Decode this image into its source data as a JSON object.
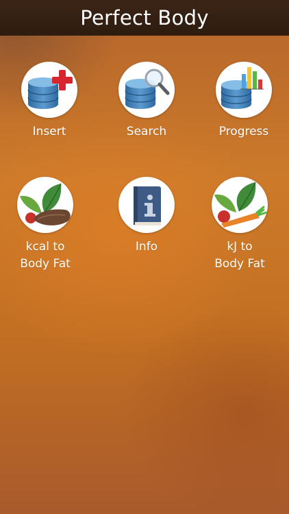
{
  "header": {
    "title": "Perfect Body"
  },
  "tiles": [
    {
      "label": "Insert",
      "icon": "database-plus-icon"
    },
    {
      "label": "Search",
      "icon": "database-search-icon"
    },
    {
      "label": "Progress",
      "icon": "database-chart-icon"
    },
    {
      "label": "kcal to\nBody Fat",
      "icon": "leaves-meat-icon"
    },
    {
      "label": "Info",
      "icon": "info-book-icon"
    },
    {
      "label": "kJ to\nBody Fat",
      "icon": "leaves-vegetables-icon"
    }
  ],
  "colors": {
    "header_bg": "#2e1c10",
    "background": "#c36f22",
    "database_blue": "#3f7fb6",
    "plus_red": "#d8262e",
    "leaf_green": "#3f8b3a"
  }
}
